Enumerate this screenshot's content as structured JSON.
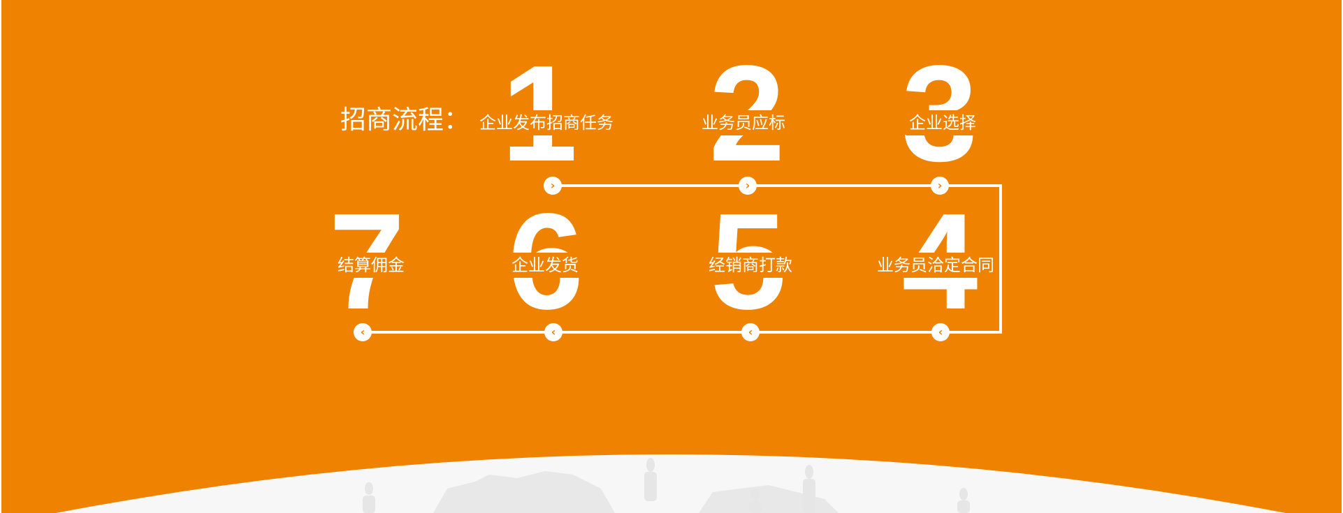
{
  "colors": {
    "background": "#ef8200",
    "foreground": "#ffffff",
    "globe": "#f7f7f7",
    "map": "#e8e8e8"
  },
  "title": "招商流程：",
  "steps": [
    {
      "number": "1",
      "label": "企业发布招商任务",
      "arrow": "chevron-right"
    },
    {
      "number": "2",
      "label": "业务员应标",
      "arrow": "chevron-right"
    },
    {
      "number": "3",
      "label": "企业选择",
      "arrow": "chevron-right"
    },
    {
      "number": "4",
      "label": "业务员洽定合同",
      "arrow": "chevron-left"
    },
    {
      "number": "5",
      "label": "经销商打款",
      "arrow": "chevron-left"
    },
    {
      "number": "6",
      "label": "企业发货",
      "arrow": "chevron-left"
    },
    {
      "number": "7",
      "label": "结算佣金",
      "arrow": "chevron-left"
    }
  ]
}
